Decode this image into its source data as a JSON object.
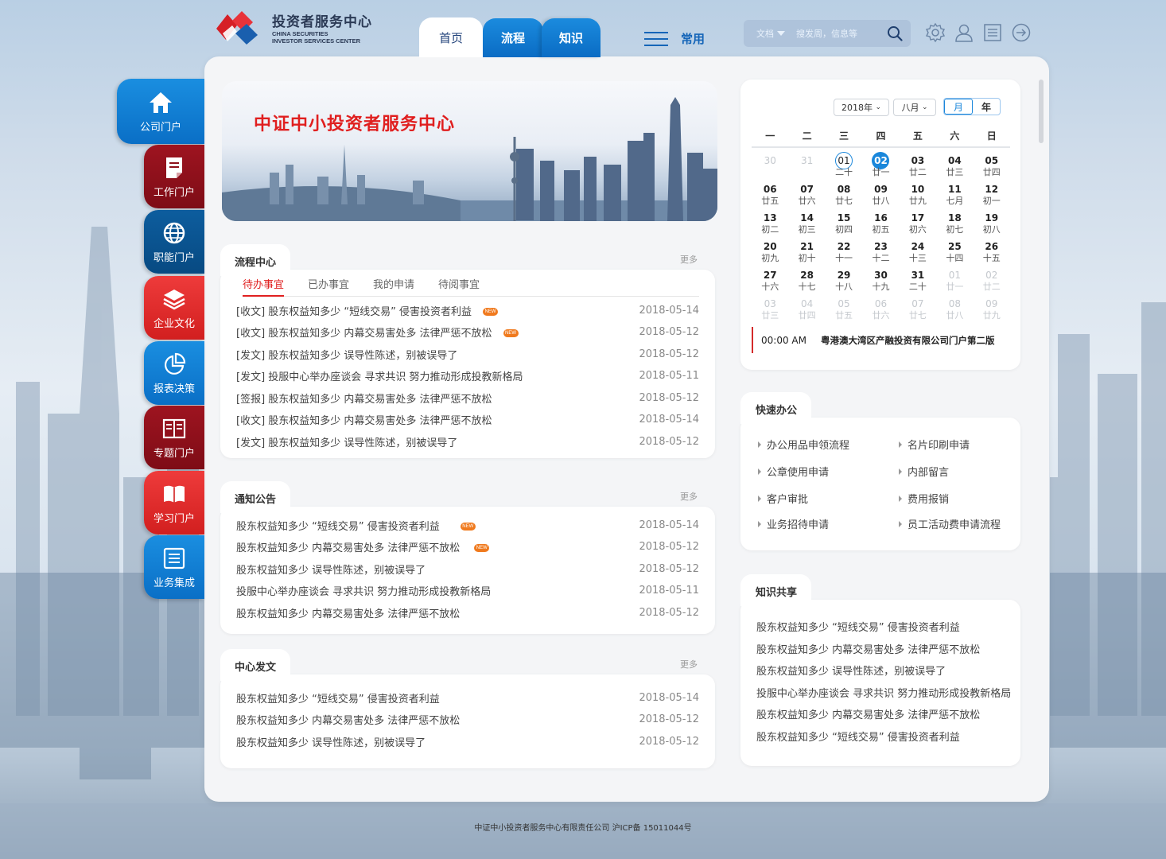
{
  "header": {
    "logo_cn": "投资者服务中心",
    "logo_en_line1": "CHINA SECURITIES",
    "logo_en_line2": "INVESTOR SERVICES CENTER",
    "tabs": [
      {
        "label": "首页",
        "active": true
      },
      {
        "label": "流程",
        "active": false
      },
      {
        "label": "知识",
        "active": false
      }
    ],
    "common_label": "常用",
    "search": {
      "category": "文档",
      "placeholder": "搜发周，信息等"
    },
    "icons": [
      "gear-icon",
      "user-icon",
      "list-icon",
      "logout-icon"
    ]
  },
  "sidenav": [
    {
      "label": "公司门户",
      "icon": "home-icon",
      "color": "#1a8ee0"
    },
    {
      "label": "工作门户",
      "icon": "document-icon",
      "color": "#9e1420"
    },
    {
      "label": "职能门户",
      "icon": "globe-icon",
      "color": "#0d5d9e"
    },
    {
      "label": "企业文化",
      "icon": "layers-icon",
      "color": "#ee3b3b"
    },
    {
      "label": "报表决策",
      "icon": "pie-chart-icon",
      "color": "#1a8ee0"
    },
    {
      "label": "专题门户",
      "icon": "book-open-icon",
      "color": "#9e1420"
    },
    {
      "label": "学习门户",
      "icon": "book-icon",
      "color": "#ee3b3b"
    },
    {
      "label": "业务集成",
      "icon": "list-icon",
      "color": "#1a8ee0"
    }
  ],
  "banner": {
    "title": "中证中小投资者服务中心"
  },
  "process_center": {
    "title": "流程中心",
    "more": "更多",
    "tabs": [
      "待办事宜",
      "已办事宜",
      "我的申请",
      "待阅事宜"
    ],
    "active_tab": 0,
    "rows": [
      {
        "text": "[收文] 股东权益知多少 “短线交易” 侵害投资者利益",
        "date": "2018-05-14",
        "new": true
      },
      {
        "text": "[收文] 股东权益知多少 内幕交易害处多 法律严惩不放松",
        "date": "2018-05-12",
        "new": true
      },
      {
        "text": "[发文] 股东权益知多少 误导性陈述，别被误导了",
        "date": "2018-05-12",
        "new": false
      },
      {
        "text": "[发文] 投服中心举办座谈会 寻求共识 努力推动形成投教新格局",
        "date": "2018-05-11",
        "new": false
      },
      {
        "text": "[签报] 股东权益知多少 内幕交易害处多 法律严惩不放松",
        "date": "2018-05-12",
        "new": false
      },
      {
        "text": "[收文] 股东权益知多少 内幕交易害处多 法律严惩不放松",
        "date": "2018-05-14",
        "new": false
      },
      {
        "text": "[发文] 股东权益知多少 误导性陈述，别被误导了",
        "date": "2018-05-12",
        "new": false
      }
    ]
  },
  "notices": {
    "title": "通知公告",
    "more": "更多",
    "rows": [
      {
        "text": "股东权益知多少 “短线交易” 侵害投资者利益",
        "date": "2018-05-14",
        "new": true
      },
      {
        "text": "股东权益知多少 内幕交易害处多 法律严惩不放松",
        "date": "2018-05-12",
        "new": true
      },
      {
        "text": "股东权益知多少 误导性陈述，别被误导了",
        "date": "2018-05-12",
        "new": false
      },
      {
        "text": "投服中心举办座谈会 寻求共识 努力推动形成投教新格局",
        "date": "2018-05-11",
        "new": false
      },
      {
        "text": "股东权益知多少 内幕交易害处多 法律严惩不放松",
        "date": "2018-05-12",
        "new": false
      }
    ]
  },
  "center_docs": {
    "title": "中心发文",
    "more": "更多",
    "rows": [
      {
        "text": "股东权益知多少 “短线交易” 侵害投资者利益",
        "date": "2018-05-14"
      },
      {
        "text": "股东权益知多少 内幕交易害处多 法律严惩不放松",
        "date": "2018-05-12"
      },
      {
        "text": "股东权益知多少 误导性陈述，别被误导了",
        "date": "2018-05-12"
      }
    ]
  },
  "badge_new": "NEW",
  "calendar": {
    "year": "2018年",
    "month": "八月",
    "view_month": "月",
    "view_year": "年",
    "weekdays": [
      "一",
      "二",
      "三",
      "四",
      "五",
      "六",
      "日"
    ],
    "days": [
      {
        "d": "30",
        "l": "",
        "dim": true
      },
      {
        "d": "31",
        "l": "",
        "dim": true
      },
      {
        "d": "01",
        "l": "二十",
        "ring": true
      },
      {
        "d": "02",
        "l": "廿一",
        "sel": true
      },
      {
        "d": "03",
        "l": "廿二"
      },
      {
        "d": "04",
        "l": "廿三"
      },
      {
        "d": "05",
        "l": "廿四"
      },
      {
        "d": "06",
        "l": "廿五"
      },
      {
        "d": "07",
        "l": "廿六"
      },
      {
        "d": "08",
        "l": "廿七"
      },
      {
        "d": "09",
        "l": "廿八"
      },
      {
        "d": "10",
        "l": "廿九"
      },
      {
        "d": "11",
        "l": "七月"
      },
      {
        "d": "12",
        "l": "初一"
      },
      {
        "d": "13",
        "l": "初二"
      },
      {
        "d": "14",
        "l": "初三"
      },
      {
        "d": "15",
        "l": "初四"
      },
      {
        "d": "16",
        "l": "初五"
      },
      {
        "d": "17",
        "l": "初六"
      },
      {
        "d": "18",
        "l": "初七"
      },
      {
        "d": "19",
        "l": "初八"
      },
      {
        "d": "20",
        "l": "初九"
      },
      {
        "d": "21",
        "l": "初十"
      },
      {
        "d": "22",
        "l": "十一"
      },
      {
        "d": "23",
        "l": "十二"
      },
      {
        "d": "24",
        "l": "十三"
      },
      {
        "d": "25",
        "l": "十四"
      },
      {
        "d": "26",
        "l": "十五"
      },
      {
        "d": "27",
        "l": "十六"
      },
      {
        "d": "28",
        "l": "十七"
      },
      {
        "d": "29",
        "l": "十八"
      },
      {
        "d": "30",
        "l": "十九"
      },
      {
        "d": "31",
        "l": "二十"
      },
      {
        "d": "01",
        "l": "廿一",
        "dim": true
      },
      {
        "d": "02",
        "l": "廿二",
        "dim": true
      },
      {
        "d": "03",
        "l": "廿三",
        "dim": true
      },
      {
        "d": "04",
        "l": "廿四",
        "dim": true
      },
      {
        "d": "05",
        "l": "廿五",
        "dim": true
      },
      {
        "d": "06",
        "l": "廿六",
        "dim": true
      },
      {
        "d": "07",
        "l": "廿七",
        "dim": true
      },
      {
        "d": "08",
        "l": "廿八",
        "dim": true
      },
      {
        "d": "09",
        "l": "廿九",
        "dim": true
      }
    ],
    "event": {
      "time": "00:00  AM",
      "title": "粤港澳大湾区产融投资有限公司门户第二版"
    }
  },
  "quick_office": {
    "title": "快速办公",
    "items": [
      "办公用品申领流程",
      "名片印刷申请",
      "公章使用申请",
      "内部留言",
      "客户审批",
      "费用报销",
      "业务招待申请",
      "员工活动费申请流程"
    ]
  },
  "knowledge": {
    "title": "知识共享",
    "rows": [
      "股东权益知多少 “短线交易” 侵害投资者利益",
      "股东权益知多少 内幕交易害处多 法律严惩不放松",
      "股东权益知多少 误导性陈述，别被误导了",
      "投服中心举办座谈会 寻求共识 努力推动形成投教新格局",
      "股东权益知多少 内幕交易害处多 法律严惩不放松",
      "股东权益知多少 “短线交易” 侵害投资者利益"
    ]
  },
  "footer": {
    "text": "中证中小投资者服务中心有限责任公司 沪ICP备 15011044号"
  }
}
